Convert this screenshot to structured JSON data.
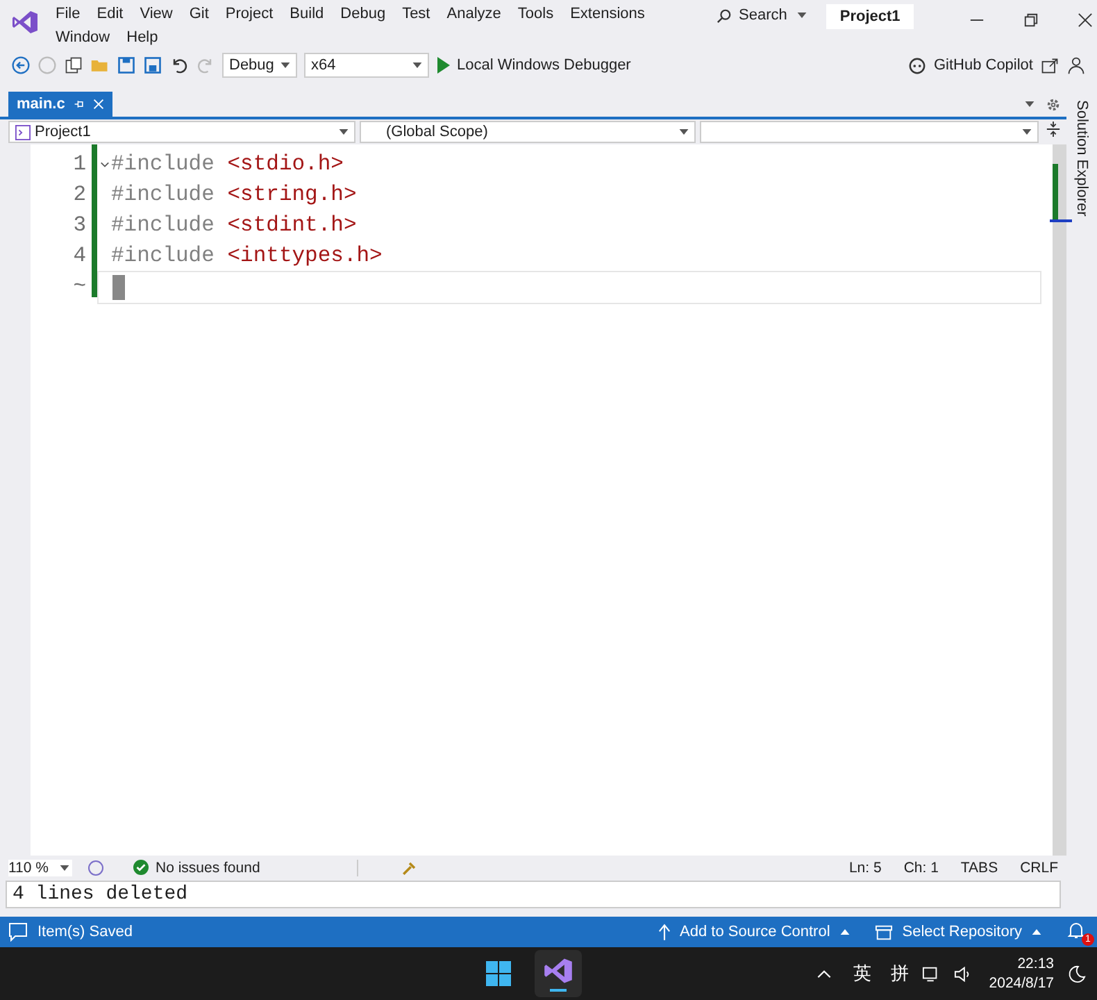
{
  "title_bar": {
    "menu": [
      "File",
      "Edit",
      "View",
      "Git",
      "Project",
      "Build",
      "Debug",
      "Test",
      "Analyze",
      "Tools",
      "Extensions",
      "Window",
      "Help"
    ],
    "search": "Search",
    "solution": "Project1"
  },
  "toolbar": {
    "configuration": "Debug",
    "platform": "x64",
    "run": "Local Windows Debugger",
    "copilot": "GitHub Copilot"
  },
  "tabs": [
    {
      "label": "main.c",
      "selected": true
    }
  ],
  "navigation_bar": {
    "project": "Project1",
    "scope": "(Global Scope)"
  },
  "editor": {
    "lines": [
      {
        "number": "1",
        "directive": "#include",
        "header": "<stdio.h>"
      },
      {
        "number": "2",
        "directive": "#include",
        "header": "<string.h>"
      },
      {
        "number": "3",
        "directive": "#include",
        "header": "<stdint.h>"
      },
      {
        "number": "4",
        "directive": "#include",
        "header": "<inttypes.h>"
      }
    ],
    "end_marker": "~"
  },
  "side_tab": "Solution Explorer",
  "editor_status": {
    "zoom": "110 %",
    "issues": "No issues found",
    "line": "Ln: 5",
    "column": "Ch: 1",
    "indent": "TABS",
    "line_ending": "CRLF"
  },
  "output_line": "4 lines deleted",
  "status_bar": {
    "message": "Item(s) Saved",
    "source_control": "Add to Source Control",
    "repository": "Select Repository",
    "notifications": "1"
  },
  "taskbar": {
    "ime_mode": "英",
    "ime": "拼",
    "time": "22:13",
    "date": "2024/8/17"
  }
}
